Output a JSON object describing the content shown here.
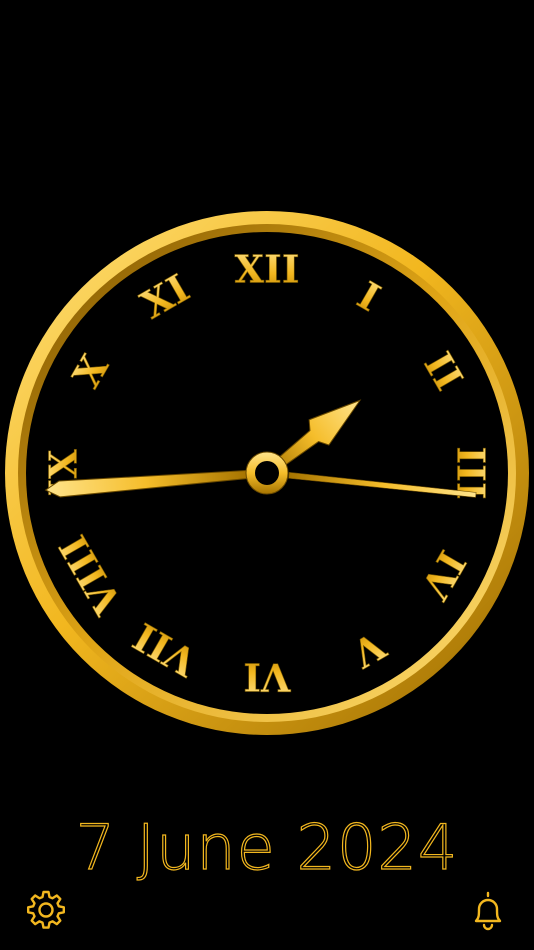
{
  "clock": {
    "numerals": [
      "XII",
      "I",
      "II",
      "III",
      "IV",
      "V",
      "VI",
      "VII",
      "VIII",
      "IX",
      "X",
      "XI"
    ],
    "time": {
      "hour": 1,
      "minute": 44,
      "second": 16
    },
    "colors": {
      "gold_light": "#ffd35a",
      "gold_mid": "#f2b71f",
      "gold_dark": "#a67400",
      "face": "#000000"
    }
  },
  "date": {
    "text": "7 June 2024"
  },
  "toolbar": {
    "settings_icon": "gear-icon",
    "alarm_icon": "bell-icon"
  }
}
